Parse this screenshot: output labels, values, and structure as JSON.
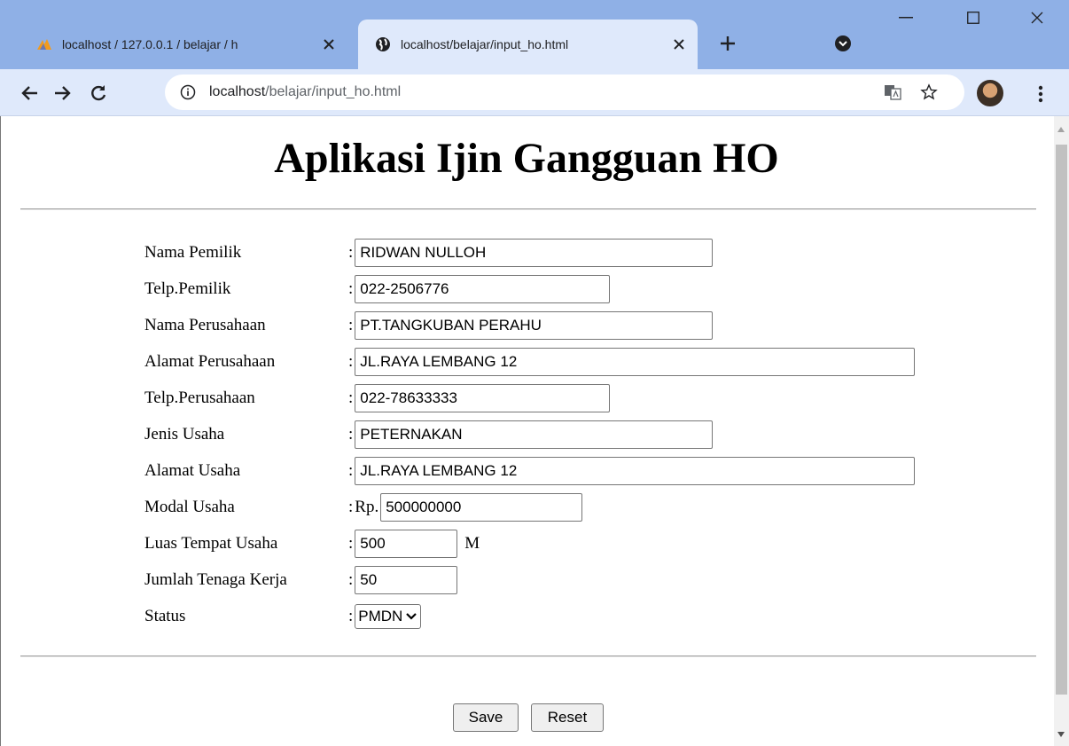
{
  "browser": {
    "tabs": [
      {
        "title": "localhost / 127.0.0.1 / belajar / h",
        "icon": "phpmyadmin-icon",
        "active": false
      },
      {
        "title": "localhost/belajar/input_ho.html",
        "icon": "globe-icon",
        "active": true
      }
    ],
    "url_host": "localhost",
    "url_path": "/belajar/input_ho.html",
    "colors": {
      "tabstrip": "#8fb0e6",
      "toolbar": "#dfe9fb"
    }
  },
  "page": {
    "title": "Aplikasi Ijin Gangguan HO",
    "form": {
      "nama_pemilik": {
        "label": "Nama Pemilik",
        "value": "RIDWAN NULLOH"
      },
      "telp_pemilik": {
        "label": "Telp.Pemilik",
        "value": "022-2506776"
      },
      "nama_perusahaan": {
        "label": "Nama Perusahaan",
        "value": "PT.TANGKUBAN PERAHU"
      },
      "alamat_perusahaan": {
        "label": "Alamat Perusahaan",
        "value": "JL.RAYA LEMBANG 12"
      },
      "telp_perusahaan": {
        "label": "Telp.Perusahaan",
        "value": "022-78633333"
      },
      "jenis_usaha": {
        "label": "Jenis Usaha",
        "value": "PETERNAKAN"
      },
      "alamat_usaha": {
        "label": "Alamat Usaha",
        "value": "JL.RAYA LEMBANG 12"
      },
      "modal_usaha": {
        "label": "Modal Usaha",
        "prefix": "Rp.",
        "value": "500000000"
      },
      "luas_tempat": {
        "label": "Luas Tempat Usaha",
        "value": "500",
        "unit": "M"
      },
      "jumlah_tenaga": {
        "label": "Jumlah Tenaga Kerja",
        "value": "50"
      },
      "status": {
        "label": "Status",
        "selected": "PMDN"
      },
      "colon": ":"
    },
    "buttons": {
      "save": "Save",
      "reset": "Reset"
    }
  }
}
